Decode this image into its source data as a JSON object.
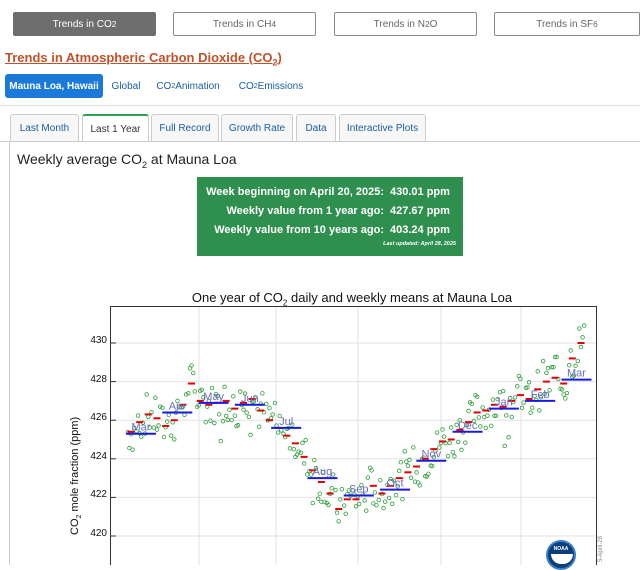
{
  "gas_tabs": [
    {
      "label_pre": "Trends in CO",
      "label_sub": "2",
      "label_post": "",
      "active": true
    },
    {
      "label_pre": "Trends in CH",
      "label_sub": "4",
      "label_post": "",
      "active": false
    },
    {
      "label_pre": "Trends in N",
      "label_sub": "2",
      "label_post": "O",
      "active": false
    },
    {
      "label_pre": "Trends in SF",
      "label_sub": "6",
      "label_post": "",
      "active": false
    }
  ],
  "page_title": {
    "pre": "Trends in Atmospheric Carbon Dioxide (CO",
    "sub": "2",
    "post": ")"
  },
  "location_tabs": [
    {
      "label_pre": "Mauna Loa, Hawaii",
      "label_sub": "",
      "label_post": "",
      "active": true
    },
    {
      "label_pre": "Global",
      "label_sub": "",
      "label_post": "",
      "active": false
    },
    {
      "label_pre": "CO",
      "label_sub": "2",
      "label_post": " Animation",
      "active": false
    },
    {
      "label_pre": "CO",
      "label_sub": "2",
      "label_post": " Emissions",
      "active": false
    }
  ],
  "view_tabs": [
    {
      "label": "Last Month",
      "active": false
    },
    {
      "label": "Last 1 Year",
      "active": true
    },
    {
      "label": "Full Record",
      "active": false
    },
    {
      "label": "Growth Rate",
      "active": false
    },
    {
      "label": "Data",
      "active": false
    },
    {
      "label": "Interactive Plots",
      "active": false
    }
  ],
  "heading": {
    "pre": "Weekly average CO",
    "sub": "2",
    "post": " at Mauna Loa"
  },
  "summary": {
    "rows": [
      {
        "label": "Week beginning on April 20, 2025:",
        "value": "430.01 ppm"
      },
      {
        "label": "Weekly value from 1 year ago:",
        "value": "427.67 ppm"
      },
      {
        "label": "Weekly value from 10 years ago:",
        "value": "403.24 ppm"
      }
    ],
    "updated": "Last updated: April 28, 2025",
    "color": "#2f8f4e"
  },
  "chart_data": {
    "type": "scatter",
    "title_pre": "One year of CO",
    "title_sub": "2",
    "title_post": " daily and weekly means at Mauna Loa",
    "ylabel_pre": "CO",
    "ylabel_sub": "2",
    "ylabel_post": " mole fraction (ppm)",
    "ylim": [
      418.5,
      432.5
    ],
    "yticks": [
      420,
      422,
      424,
      426,
      428,
      430
    ],
    "grid": true,
    "credit": "5-April-28",
    "monthly": [
      {
        "month": "Mar",
        "value": 425.3
      },
      {
        "month": "Apr",
        "value": 426.4
      },
      {
        "month": "May",
        "value": 426.9
      },
      {
        "month": "Jun",
        "value": 426.8
      },
      {
        "month": "Jul",
        "value": 425.6
      },
      {
        "month": "Aug",
        "value": 423.0
      },
      {
        "month": "Sep",
        "value": 422.1
      },
      {
        "month": "Oct",
        "value": 422.4
      },
      {
        "month": "Nov",
        "value": 423.9
      },
      {
        "month": "Dec",
        "value": 425.4
      },
      {
        "month": "Jan",
        "value": 426.6
      },
      {
        "month": "Feb",
        "value": 427.0
      },
      {
        "month": "Mar",
        "value": 428.1
      }
    ],
    "weekly": [
      425.4,
      425.9,
      426.3,
      426.1,
      425.7,
      426.0,
      426.8,
      427.9,
      427.0,
      426.8,
      426.9,
      427.0,
      426.6,
      426.9,
      427.1,
      426.5,
      426.0,
      425.6,
      425.2,
      424.8,
      424.1,
      423.4,
      422.8,
      422.2,
      421.4,
      421.9,
      421.9,
      422.1,
      422.6,
      422.2,
      422.6,
      423.0,
      423.3,
      423.6,
      424.0,
      424.5,
      424.9,
      425.0,
      425.5,
      425.9,
      426.4,
      426.5,
      426.8,
      426.7,
      427.0,
      427.3,
      427.1,
      427.6,
      428.0,
      428.2,
      427.9,
      429.2,
      430.0
    ],
    "daily_color": "#2e9e3a",
    "weekly_color": "#e00000",
    "monthly_color": "#1a1adf"
  }
}
